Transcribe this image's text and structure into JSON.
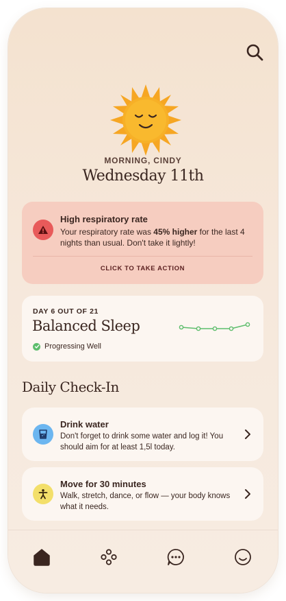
{
  "greeting": "MORNING, CINDY",
  "date": "Wednesday 11th",
  "alert": {
    "title": "High respiratory rate",
    "body_prefix": "Your respiratory rate was ",
    "body_bold": "45% higher",
    "body_suffix": " for the last 4 nights than usual. Don't take it lightly!",
    "action": "CLICK TO TAKE ACTION"
  },
  "program": {
    "day": "DAY 6 OUT OF 21",
    "title": "Balanced Sleep",
    "status": "Progressing Well"
  },
  "daily_checkin": {
    "title": "Daily Check-In",
    "items": [
      {
        "title": "Drink water",
        "body": "Don't forget to drink some water and log it! You should aim for at least 1,5l today.",
        "icon": "water-glass-icon",
        "icon_color": "#6cb6f0"
      },
      {
        "title": "Move for 30 minutes",
        "body": "Walk, stretch, dance, or flow — your body knows what it needs.",
        "icon": "person-moving-icon",
        "icon_color": "#f3df6a"
      }
    ]
  },
  "colors": {
    "alert_bg": "#f6cdc0",
    "alert_icon": "#e85a5a",
    "progress_green": "#5dbd6c",
    "sun_orange": "#f6a623"
  },
  "tabs": [
    "home-icon",
    "program-icon",
    "chat-icon",
    "profile-icon"
  ]
}
